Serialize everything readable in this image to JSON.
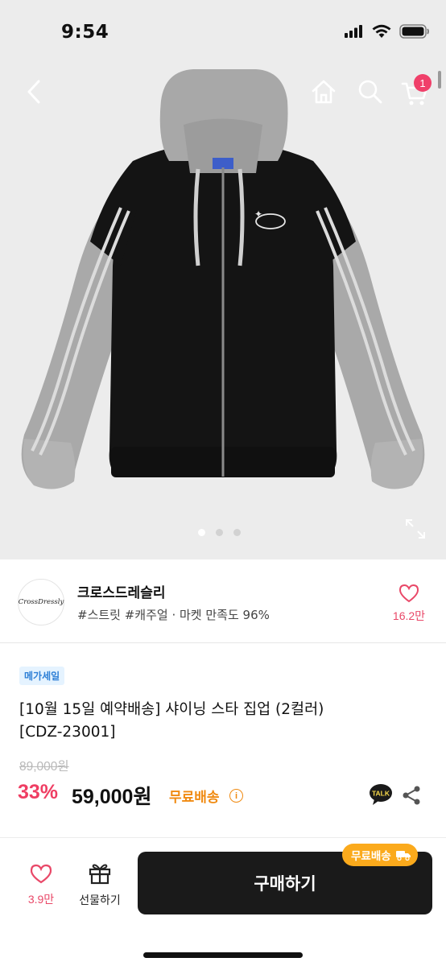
{
  "status_bar": {
    "time": "9:54"
  },
  "nav": {
    "cart_count": "1"
  },
  "gallery": {
    "image_count": 3,
    "active_index": 0
  },
  "store": {
    "logo_text": "CrossDressly",
    "name": "크로스드레슬리",
    "tags": "#스트릿 #캐주얼 · 마켓 만족도 96%",
    "like_count": "16.2만"
  },
  "product": {
    "badge": "메가세일",
    "title_line1": "[10월 15일 예약배송] 샤이닝 스타 집업 (2컬러)",
    "title_line2": "[CDZ-23001]",
    "original_price": "89,000원",
    "discount": "33%",
    "price": "59,000원",
    "shipping": "무료배송",
    "talk_label": "TALK"
  },
  "bottom_bar": {
    "like_count": "3.9만",
    "gift_label": "선물하기",
    "buy_label": "구매하기",
    "free_shipping_tag": "무료배송"
  },
  "colors": {
    "accent_pink": "#ef3e63",
    "shipping_orange": "#f08a11",
    "badge_blue": "#2d7fd6",
    "buy_button": "#1a1a1a"
  }
}
